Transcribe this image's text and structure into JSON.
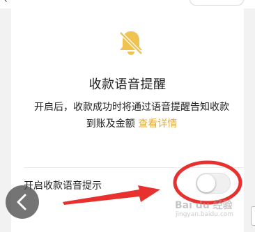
{
  "page": {
    "title": "收款语音提醒",
    "description_text": "开启后，收款成功时将通过语音提醒告知收款到账及金额",
    "details_link": "查看详情"
  },
  "settings": {
    "voice_prompt_label": "开启收款语音提示",
    "voice_prompt_enabled": false
  },
  "icons": {
    "bell": "bell-muted-icon",
    "back": "chevron-left-icon"
  },
  "colors": {
    "accent": "#f0c24f",
    "link": "#e3ab39",
    "annotation": "#e8302f"
  },
  "watermark": {
    "brand": "Bai du 经验",
    "url": "jingyan.baidu.com"
  }
}
